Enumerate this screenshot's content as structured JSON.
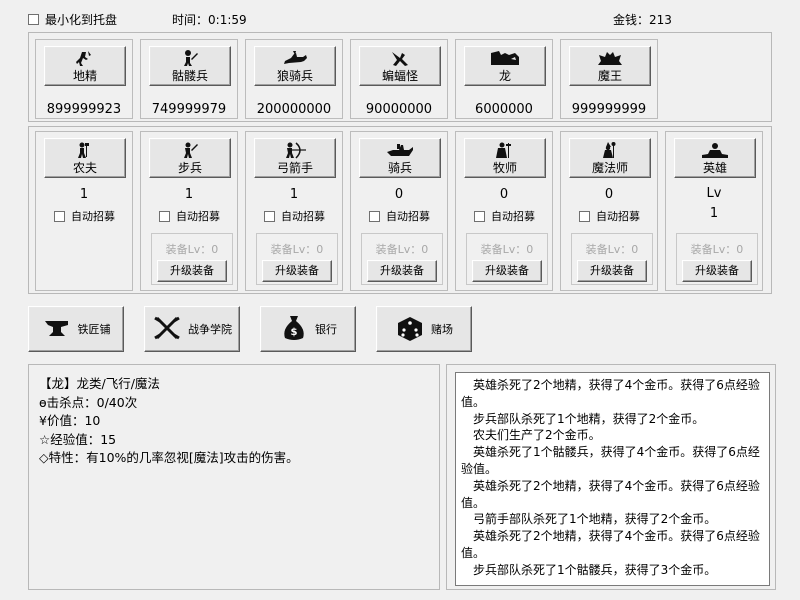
{
  "top": {
    "minimize_label": "最小化到托盘",
    "time_label": "时间：",
    "time_value": "0:1:59",
    "money_label": "金钱：",
    "money_value": "213"
  },
  "monsters": [
    {
      "name": "地精",
      "count": "899999923",
      "icon": "goblin-icon"
    },
    {
      "name": "骷髅兵",
      "count": "749999979",
      "icon": "skeleton-icon"
    },
    {
      "name": "狼骑兵",
      "count": "200000000",
      "icon": "wolf-rider-icon"
    },
    {
      "name": "蝙蝠怪",
      "count": "90000000",
      "icon": "bat-icon"
    },
    {
      "name": "龙",
      "count": "6000000",
      "icon": "dragon-icon"
    },
    {
      "name": "魔王",
      "count": "999999999",
      "icon": "demon-king-icon"
    }
  ],
  "units": [
    {
      "name": "农夫",
      "count": "1",
      "auto_label": "自动招募",
      "icon": "farmer-icon"
    },
    {
      "name": "步兵",
      "count": "1",
      "auto_label": "自动招募",
      "equip": "装备Lv：0",
      "upgrade": "升级装备",
      "icon": "infantry-icon"
    },
    {
      "name": "弓箭手",
      "count": "1",
      "auto_label": "自动招募",
      "equip": "装备Lv：0",
      "upgrade": "升级装备",
      "icon": "archer-icon"
    },
    {
      "name": "骑兵",
      "count": "0",
      "auto_label": "自动招募",
      "equip": "装备Lv：0",
      "upgrade": "升级装备",
      "icon": "cavalry-icon"
    },
    {
      "name": "牧师",
      "count": "0",
      "auto_label": "自动招募",
      "equip": "装备Lv：0",
      "upgrade": "升级装备",
      "icon": "priest-icon"
    },
    {
      "name": "魔法师",
      "count": "0",
      "auto_label": "自动招募",
      "equip": "装备Lv：0",
      "upgrade": "升级装备",
      "icon": "mage-icon"
    }
  ],
  "hero": {
    "name": "英雄",
    "lv_label": "Lv",
    "lv_value": "1",
    "equip": "装备Lv：0",
    "upgrade": "升级装备",
    "icon": "hero-icon"
  },
  "buildings": [
    {
      "label": "铁匠铺",
      "icon": "anvil-icon"
    },
    {
      "label": "战争学院",
      "icon": "crossed-swords-icon"
    },
    {
      "label": "银行",
      "icon": "money-bag-icon"
    },
    {
      "label": "赌场",
      "icon": "dice-icon"
    }
  ],
  "info": {
    "title": "【龙】龙类/飞行/魔法",
    "kills": "ɵ击杀点：0/40次",
    "value": "¥价值：10",
    "exp": "☆经验值：15",
    "trait": "◇特性：有10%的几率忽视[魔法]攻击的伤害。"
  },
  "log": [
    "英雄杀死了2个地精，获得了4个金币。获得了6点经验值。",
    "步兵部队杀死了1个地精，获得了2个金币。",
    "农夫们生产了2个金币。",
    "英雄杀死了1个骷髅兵，获得了4个金币。获得了6点经验值。",
    "英雄杀死了2个地精，获得了4个金币。获得了6点经验值。",
    "弓箭手部队杀死了1个地精，获得了2个金币。",
    "英雄杀死了2个地精，获得了4个金币。获得了6点经验值。",
    "步兵部队杀死了1个骷髅兵，获得了3个金币。"
  ],
  "colors": {
    "background": "#f0f0f0",
    "button": "#e6e6e6",
    "disabled_text": "#a8a8a8"
  }
}
